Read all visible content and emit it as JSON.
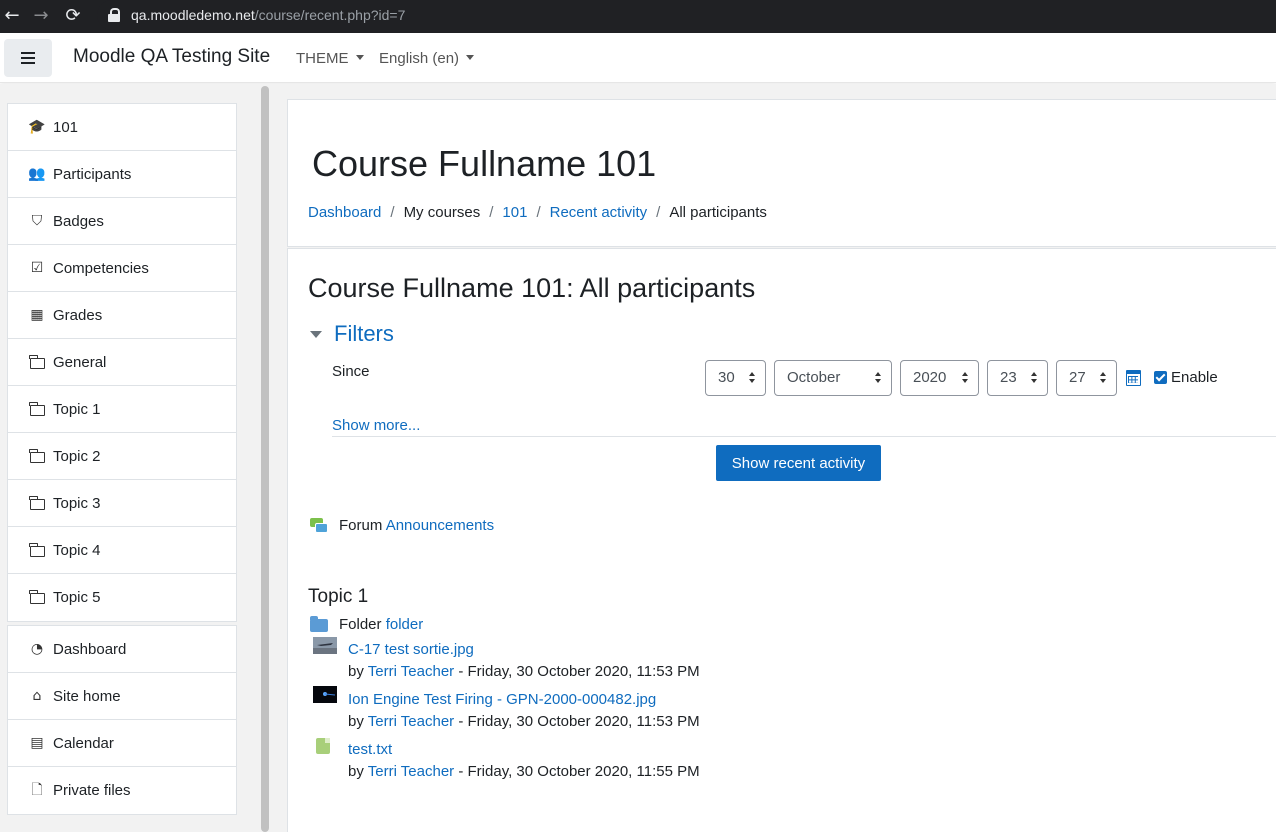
{
  "browser": {
    "url_host": "qa.moodledemo.net",
    "url_path": "/course/recent.php?id=7"
  },
  "navbar": {
    "site_name": "Moodle QA Testing Site",
    "theme_menu": "THEME",
    "language_menu": "English (en)"
  },
  "sidebar": {
    "course_items": [
      {
        "label": "101",
        "icon": "graduation-cap-icon"
      },
      {
        "label": "Participants",
        "icon": "users-icon"
      },
      {
        "label": "Badges",
        "icon": "shield-icon"
      },
      {
        "label": "Competencies",
        "icon": "check-square-icon"
      },
      {
        "label": "Grades",
        "icon": "table-icon"
      },
      {
        "label": "General",
        "icon": "folder-icon"
      },
      {
        "label": "Topic 1",
        "icon": "folder-icon"
      },
      {
        "label": "Topic 2",
        "icon": "folder-icon"
      },
      {
        "label": "Topic 3",
        "icon": "folder-icon"
      },
      {
        "label": "Topic 4",
        "icon": "folder-icon"
      },
      {
        "label": "Topic 5",
        "icon": "folder-icon"
      }
    ],
    "site_items": [
      {
        "label": "Dashboard",
        "icon": "dashboard-icon"
      },
      {
        "label": "Site home",
        "icon": "home-icon"
      },
      {
        "label": "Calendar",
        "icon": "calendar-icon"
      },
      {
        "label": "Private files",
        "icon": "file-icon"
      }
    ]
  },
  "header": {
    "course_title": "Course Fullname 101",
    "breadcrumb": [
      "Dashboard",
      "My courses",
      "101",
      "Recent activity",
      "All participants"
    ],
    "breadcrumb_sep": "/"
  },
  "content": {
    "heading": "Course Fullname 101: All participants",
    "filters": {
      "legend": "Filters",
      "since_label": "Since",
      "day": "30",
      "month": "October",
      "year": "2020",
      "hour": "23",
      "minute": "27",
      "enable_label": "Enable",
      "enable_checked": true,
      "show_more": "Show more...",
      "submit": "Show recent activity"
    },
    "forum": {
      "type": "Forum",
      "name": "Announcements"
    },
    "topic": {
      "heading": "Topic 1",
      "folder_type": "Folder",
      "folder_name": "folder",
      "files": [
        {
          "name": "C-17 test sortie.jpg",
          "by": "by",
          "author": "Terri Teacher",
          "date": "- Friday, 30 October 2020, 11:53 PM"
        },
        {
          "name": "Ion Engine Test Firing - GPN-2000-000482.jpg",
          "by": "by",
          "author": "Terri Teacher",
          "date": "- Friday, 30 October 2020, 11:53 PM"
        },
        {
          "name": "test.txt",
          "by": "by",
          "author": "Terri Teacher",
          "date": "- Friday, 30 October 2020, 11:55 PM"
        }
      ]
    }
  },
  "colors": {
    "link": "#0f6cbf",
    "primary_button": "#0f6cbf",
    "page_bg": "#f2f2f2"
  }
}
